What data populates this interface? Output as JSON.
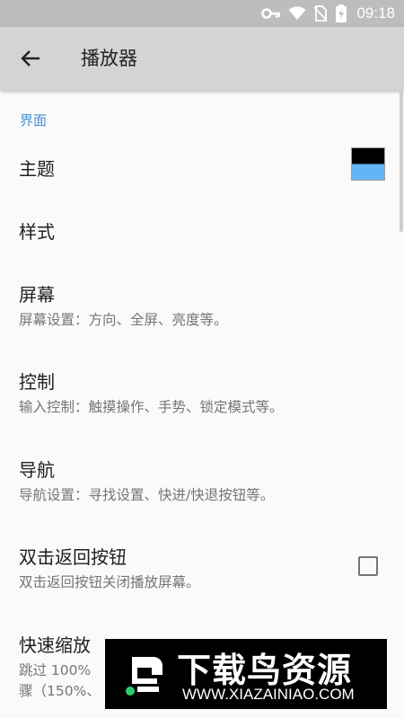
{
  "status_bar": {
    "time": "09:18",
    "icons": [
      "key-icon",
      "wifi-icon",
      "no-sim-icon",
      "battery-charging-icon"
    ]
  },
  "app_bar": {
    "title": "播放器",
    "back_icon": "arrow-left-icon"
  },
  "section": {
    "header": "界面"
  },
  "preferences": {
    "theme": {
      "title": "主题",
      "swatch_colors": [
        "#000000",
        "#64b5f6"
      ]
    },
    "style": {
      "title": "样式"
    },
    "screen": {
      "title": "屏幕",
      "summary": "屏幕设置：方向、全屏、亮度等。"
    },
    "control": {
      "title": "控制",
      "summary": "输入控制：触摸操作、手势、锁定模式等。"
    },
    "navigation": {
      "title": "导航",
      "summary": "导航设置：寻找设置、快进/快退按钮等。"
    },
    "double_tap_back": {
      "title": "双击返回按钮",
      "summary": "双击返回按钮关闭播放屏幕。",
      "checked": false
    },
    "quick_zoom": {
      "title": "快速缩放",
      "summary_line1": "跳过 100%",
      "summary_line2": "骤（150%、"
    }
  },
  "watermark": {
    "name": "下载鸟资源",
    "url": "WWW.XIAZAINIAO.COM"
  }
}
